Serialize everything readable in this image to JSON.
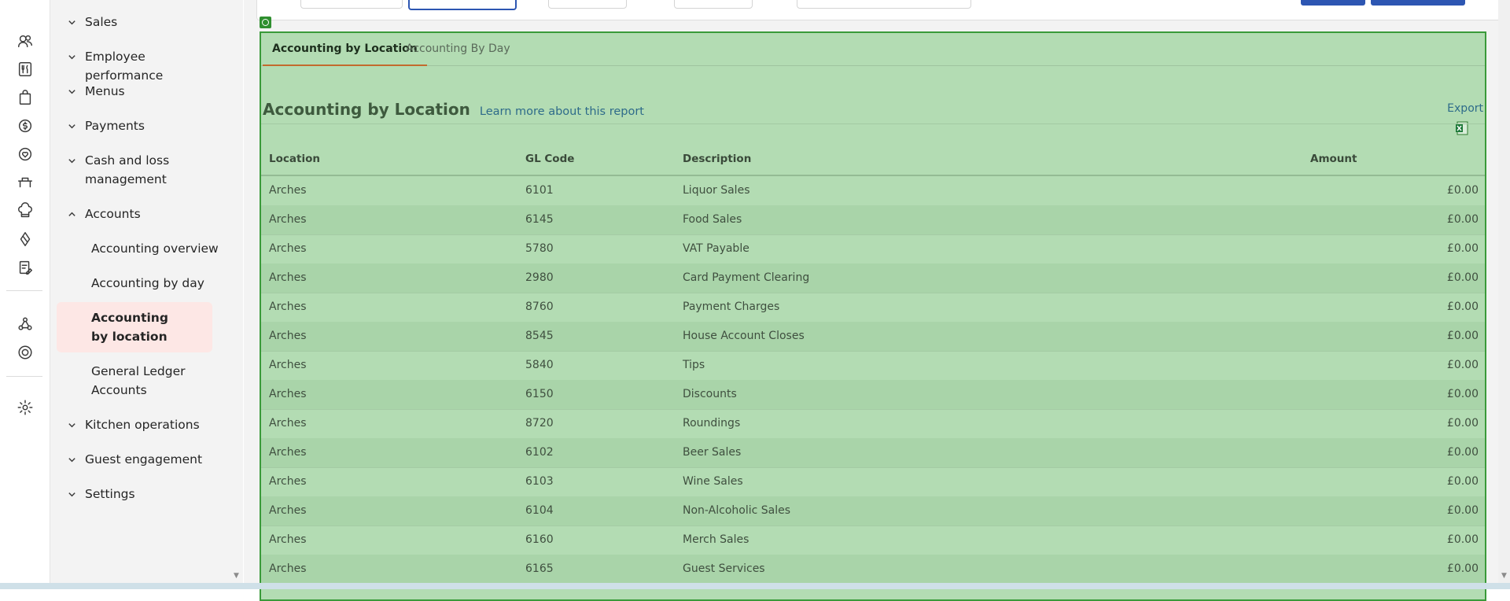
{
  "sidebar": {
    "items": [
      {
        "label": "Sales",
        "icon": "chevron-down-icon"
      },
      {
        "label": "Employee performance",
        "icon": "chevron-down-icon"
      },
      {
        "label": "Menus",
        "icon": "chevron-down-icon"
      },
      {
        "label": "Payments",
        "icon": "chevron-down-icon"
      },
      {
        "label": "Cash and loss management",
        "icon": "chevron-down-icon"
      },
      {
        "label": "Accounts",
        "icon": "chevron-up-icon"
      },
      {
        "label": "Kitchen operations",
        "icon": "chevron-down-icon"
      },
      {
        "label": "Guest engagement",
        "icon": "chevron-down-icon"
      },
      {
        "label": "Settings",
        "icon": "chevron-down-icon"
      }
    ],
    "accounts_sub": [
      {
        "label": "Accounting overview"
      },
      {
        "label": "Accounting by day"
      },
      {
        "label": "Accounting by location"
      },
      {
        "label": "General Ledger Accounts"
      }
    ]
  },
  "tabs": {
    "by_location": "Accounting by Location",
    "by_day": "Accounting By Day"
  },
  "report": {
    "title": "Accounting by Location",
    "learn_link": "Learn more about this report",
    "export_label": "Export"
  },
  "table": {
    "headers": {
      "location": "Location",
      "gl_code": "GL Code",
      "description": "Description",
      "amount": "Amount"
    },
    "rows": [
      {
        "location": "Arches",
        "gl_code": "6101",
        "description": "Liquor Sales",
        "amount": "£0.00"
      },
      {
        "location": "Arches",
        "gl_code": "6145",
        "description": "Food Sales",
        "amount": "£0.00"
      },
      {
        "location": "Arches",
        "gl_code": "5780",
        "description": "VAT Payable",
        "amount": "£0.00"
      },
      {
        "location": "Arches",
        "gl_code": "2980",
        "description": "Card Payment Clearing",
        "amount": "£0.00"
      },
      {
        "location": "Arches",
        "gl_code": "8760",
        "description": "Payment Charges",
        "amount": "£0.00"
      },
      {
        "location": "Arches",
        "gl_code": "8545",
        "description": "House Account Closes",
        "amount": "£0.00"
      },
      {
        "location": "Arches",
        "gl_code": "5840",
        "description": "Tips",
        "amount": "£0.00"
      },
      {
        "location": "Arches",
        "gl_code": "6150",
        "description": "Discounts",
        "amount": "£0.00"
      },
      {
        "location": "Arches",
        "gl_code": "8720",
        "description": "Roundings",
        "amount": "£0.00"
      },
      {
        "location": "Arches",
        "gl_code": "6102",
        "description": "Beer Sales",
        "amount": "£0.00"
      },
      {
        "location": "Arches",
        "gl_code": "6103",
        "description": "Wine Sales",
        "amount": "£0.00"
      },
      {
        "location": "Arches",
        "gl_code": "6104",
        "description": "Non-Alcoholic Sales",
        "amount": "£0.00"
      },
      {
        "location": "Arches",
        "gl_code": "6160",
        "description": "Merch Sales",
        "amount": "£0.00"
      },
      {
        "location": "Arches",
        "gl_code": "6165",
        "description": "Guest Services",
        "amount": "£0.00"
      }
    ]
  },
  "colors": {
    "panel_bg": "#b3dcb3",
    "panel_border": "#3a9a3a",
    "active_item_bg": "#fde7e5",
    "primary_blue": "#2d56b2",
    "tab_underline": "#c36a2d"
  }
}
